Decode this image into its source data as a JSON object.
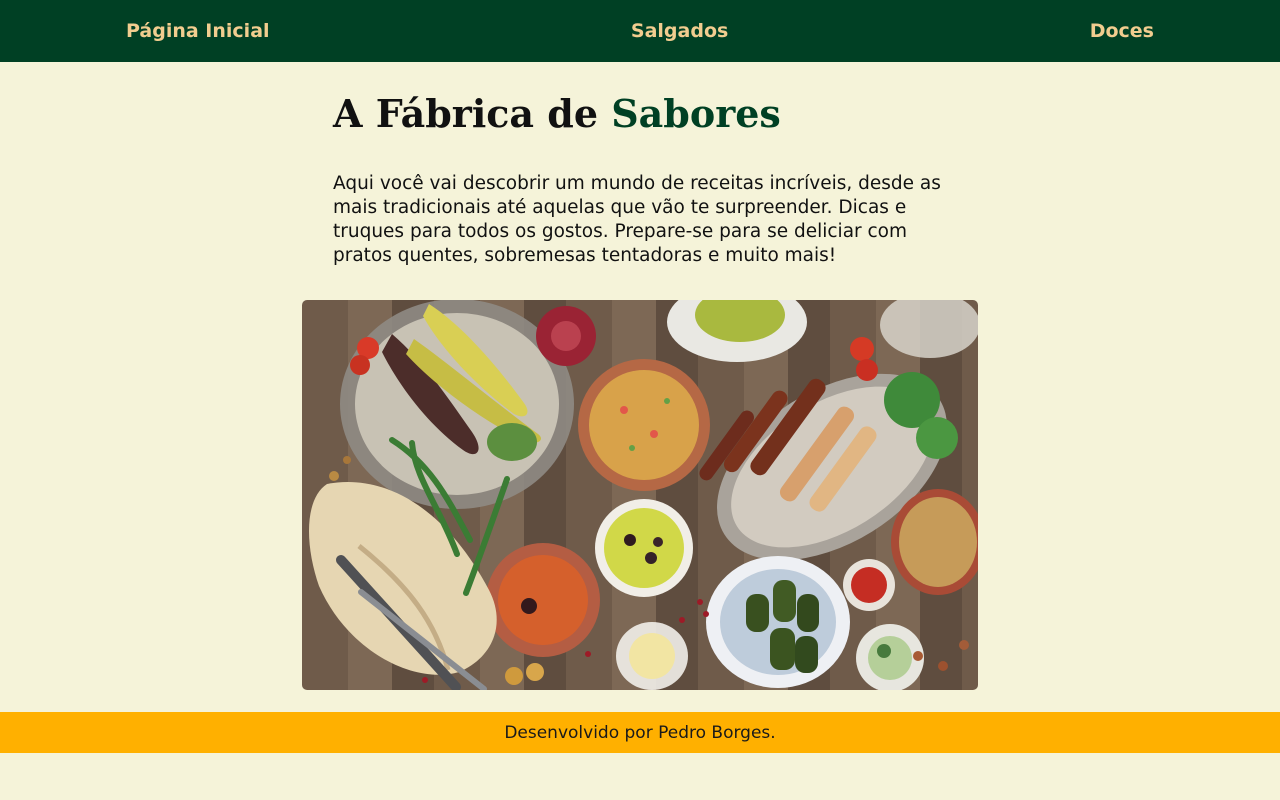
{
  "nav": {
    "home": "Página Inicial",
    "salgados": "Salgados",
    "doces": "Doces"
  },
  "hero": {
    "title_prefix": "A Fábrica de",
    "title_accent": "Sabores",
    "intro": "Aqui você vai descobrir um mundo de receitas incríveis, desde as mais tradicionais até aquelas que vão te surpreender. Dicas e truques para todos os gostos. Prepare-se para se deliciar com pratos quentes, sobremesas tentadoras e muito mais!"
  },
  "footer": {
    "credit": "Desenvolvido por Pedro Borges."
  },
  "colors": {
    "nav_bg": "#004024",
    "nav_text": "#f1cd8f",
    "page_bg": "#f5f3d9",
    "accent": "#004024",
    "footer_bg": "#ffb000"
  }
}
